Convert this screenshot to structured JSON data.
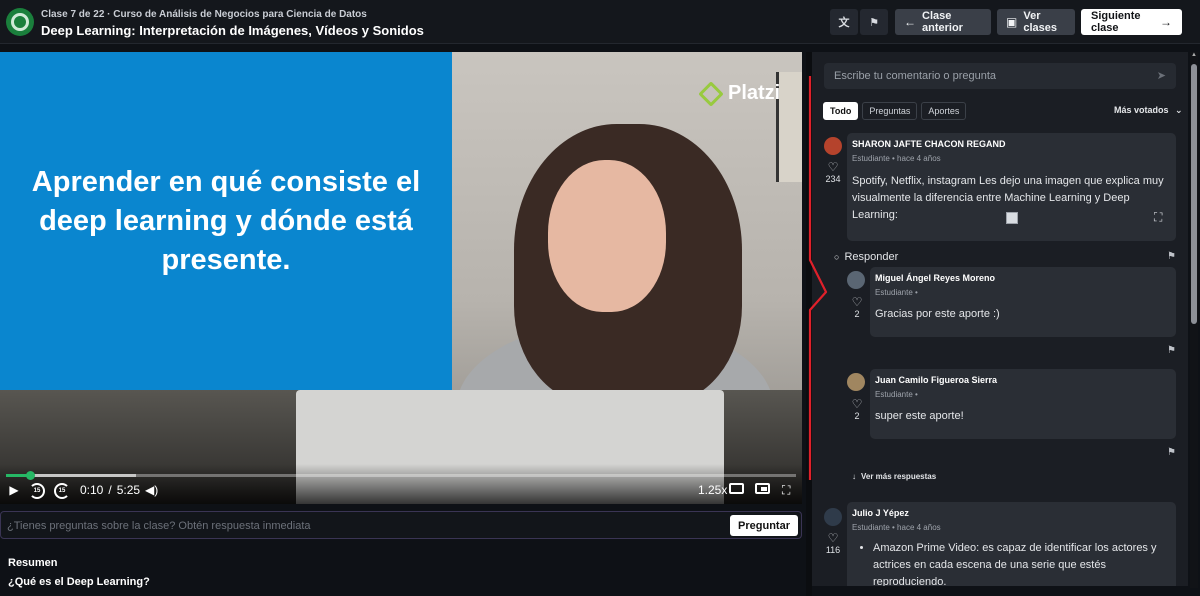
{
  "header": {
    "course_line": "Clase 7 de 22 · Curso de Análisis de Negocios para Ciencia de Datos",
    "class_title": "Deep Learning: Interpretación de Imágenes, Vídeos y Sonidos",
    "translate_icon": "translate-icon",
    "flag_icon": "flag-icon",
    "prev_label": "Clase anterior",
    "view_classes_label": "Ver clases",
    "next_label": "Siguiente clase"
  },
  "video": {
    "slide_text": "Aprender en qué consiste el deep learning y dónde está presente.",
    "watermark": "Platzi",
    "current_time": "0:10",
    "separator": "/",
    "duration": "5:25",
    "speed": "1.25x",
    "rewind_label": "15",
    "forward_label": "15",
    "progress_fraction": 0.031,
    "buffered_fraction": 0.165
  },
  "ask": {
    "placeholder": "¿Tienes preguntas sobre la clase? Obtén respuesta inmediata",
    "button": "Preguntar"
  },
  "summary": {
    "title": "Resumen",
    "question": "¿Qué es el Deep Learning?"
  },
  "comments": {
    "input_placeholder": "Escribe tu comentario o pregunta",
    "filters": [
      "Todo",
      "Preguntas",
      "Aportes"
    ],
    "sort_label": "Más votados",
    "reply_label": "Responder",
    "more_replies_label": "Ver más respuestas",
    "items": [
      {
        "author": "SHARON JAFTE CHACON REGAND",
        "meta": "Estudiante • hace 4 años",
        "likes": "234",
        "text": "Spotify, Netflix, instagram Les dejo una imagen que explica muy visualmente la diferencia entre Machine Learning y Deep Learning:"
      },
      {
        "author": "Miguel Ángel Reyes Moreno",
        "meta": "Estudiante •",
        "likes": "2",
        "text": "Gracias por este aporte :)"
      },
      {
        "author": "Juan Camilo Figueroa Sierra",
        "meta": "Estudiante •",
        "likes": "2",
        "text": "super este aporte!"
      },
      {
        "author": "Julio J Yépez",
        "meta": "Estudiante • hace 4 años",
        "likes": "116",
        "text": "Amazon Prime Video: es capaz de identificar los actores y actrices en cada escena de una serie que estés reproduciendo."
      }
    ]
  },
  "colors": {
    "accent": "#26b865",
    "slide_blue": "#0a86cf",
    "annotation": "#e0202a"
  }
}
